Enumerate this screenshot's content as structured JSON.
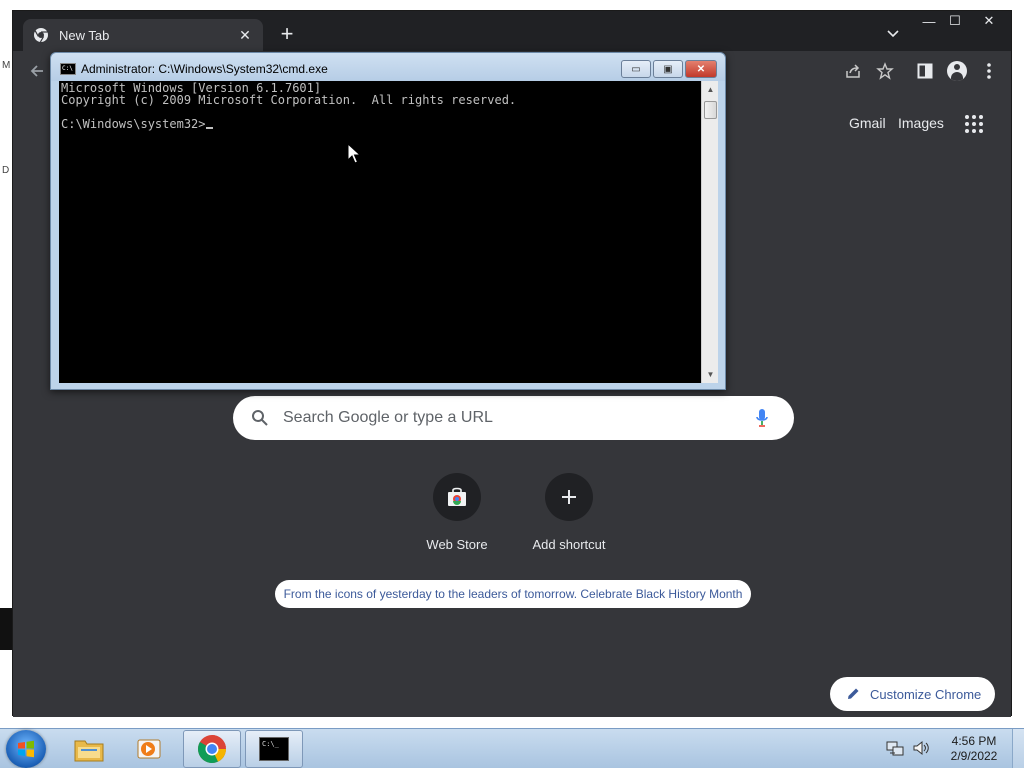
{
  "desktop": {
    "glyph_top": "M",
    "glyph_mid": "D"
  },
  "chrome": {
    "tab_title": "New Tab",
    "tab_close": "✕",
    "new_tab": "+",
    "window_controls": {
      "minimize": "—",
      "maximize": "☐",
      "close": "✕"
    },
    "top_links": {
      "gmail": "Gmail",
      "images": "Images"
    },
    "search_placeholder": "Search Google or type a URL",
    "shortcuts": [
      {
        "label": "Web Store",
        "icon": "web-store-icon"
      },
      {
        "label": "Add shortcut",
        "icon": "plus-icon"
      }
    ],
    "promo_text": "From the icons of yesterday to the leaders of tomorrow. Celebrate Black History Month",
    "customize_label": "Customize Chrome"
  },
  "cmd": {
    "title": "Administrator: C:\\Windows\\System32\\cmd.exe",
    "icon_text": "C:\\",
    "lines": [
      "Microsoft Windows [Version 6.1.7601]",
      "Copyright (c) 2009 Microsoft Corporation.  All rights reserved.",
      "",
      "C:\\Windows\\system32>"
    ],
    "controls": {
      "minimize": "▭",
      "maximize": "▣",
      "close": "✕"
    }
  },
  "taskbar": {
    "items": [
      "windows-explorer",
      "media-player",
      "google-chrome",
      "command-prompt"
    ],
    "cmd_icon_text": "C:\\_",
    "clock_time": "4:56 PM",
    "clock_date": "2/9/2022"
  },
  "colors": {
    "chrome_bg": "#35363a",
    "chrome_frame": "#202124",
    "accent_link": "#3c5a9a",
    "taskbar": "#b9cfe6"
  }
}
